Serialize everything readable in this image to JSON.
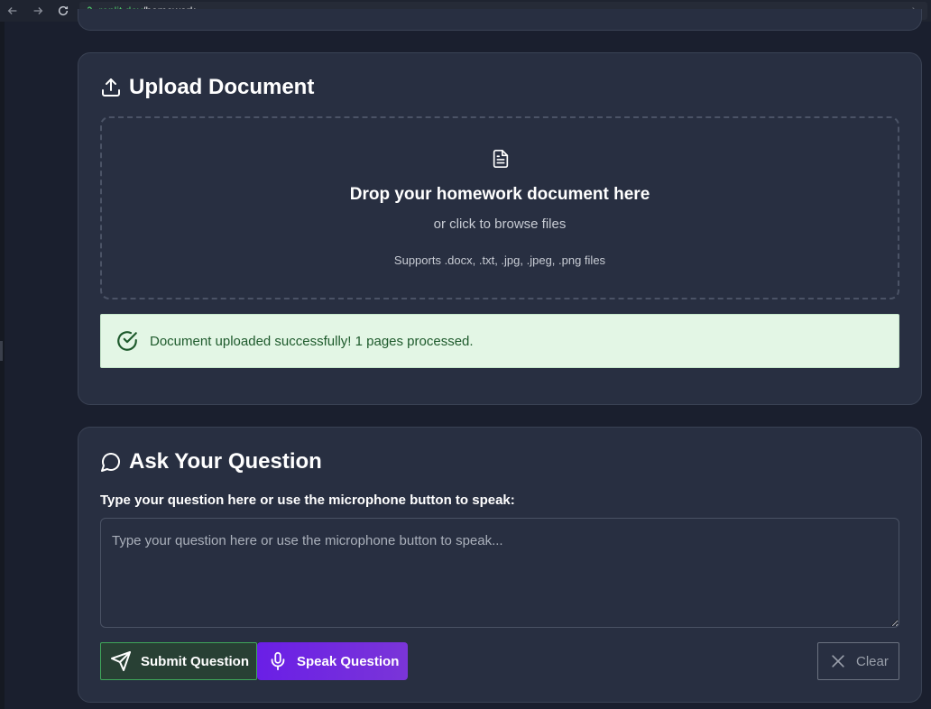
{
  "browser": {
    "url_domain": ".replit.dev",
    "url_path": "/homework"
  },
  "upload": {
    "title": "Upload Document",
    "drop_title": "Drop your homework document here",
    "drop_sub": "or click to browse files",
    "drop_note": "Supports .docx, .txt, .jpg, .jpeg, .png files",
    "success_message": "Document uploaded successfully! 1 pages processed."
  },
  "question": {
    "title": "Ask Your Question",
    "label": "Type your question here or use the microphone button to speak:",
    "placeholder": "Type your question here or use the microphone button to speak...",
    "value": "",
    "submit_label": "Submit Question",
    "speak_label": "Speak Question",
    "clear_label": "Clear"
  },
  "colors": {
    "background": "#1a1f2e",
    "card": "#282f41",
    "success_bg": "#e3f6e5",
    "success_text": "#1e5a2c",
    "submit_border": "#3fa75a",
    "speak_accent": "#6a1fe6"
  }
}
